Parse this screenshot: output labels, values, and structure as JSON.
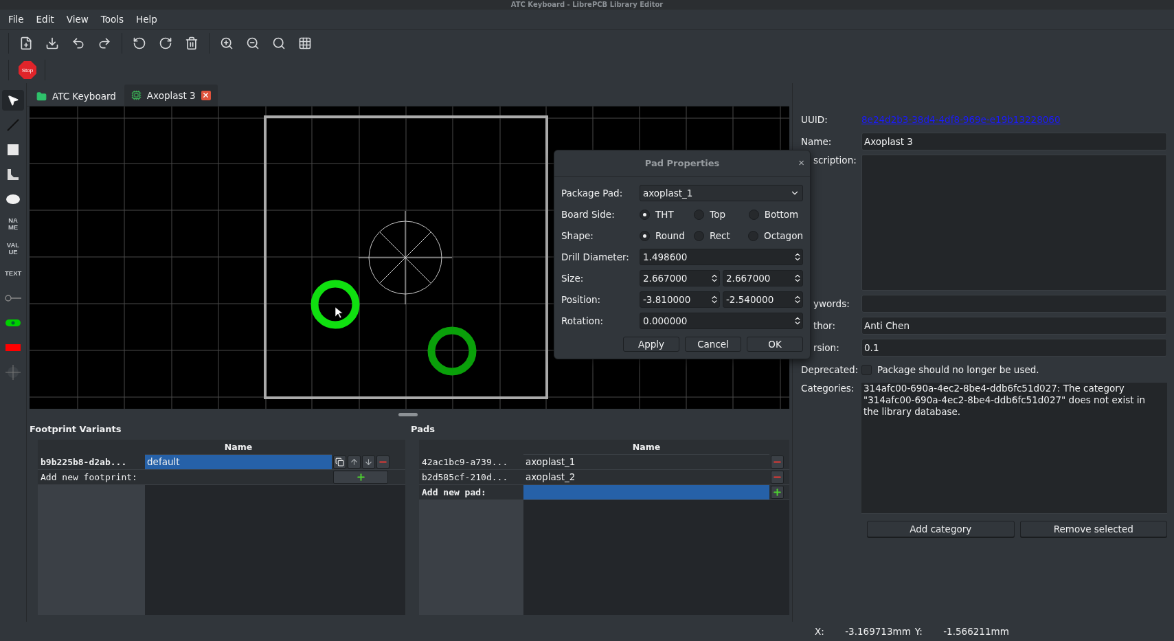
{
  "window": {
    "title": "ATC Keyboard - LibrePCB Library Editor"
  },
  "menu": [
    "File",
    "Edit",
    "View",
    "Tools",
    "Help"
  ],
  "stop_label": "Stop",
  "tools": [
    {
      "kind": "pointer",
      "selected": true
    },
    {
      "kind": "line",
      "selected": false
    },
    {
      "kind": "rect",
      "selected": false
    },
    {
      "kind": "polygon",
      "selected": false
    },
    {
      "kind": "ellipse",
      "selected": false
    },
    {
      "kind": "label",
      "label": "NA ME",
      "selected": false
    },
    {
      "kind": "label",
      "label": "VAL UE",
      "selected": false
    },
    {
      "kind": "small",
      "label": "TEXT",
      "selected": false
    },
    {
      "kind": "hole",
      "selected": false
    },
    {
      "kind": "tht",
      "selected": false
    },
    {
      "kind": "smt",
      "selected": false
    },
    {
      "kind": "origin",
      "selected": false
    }
  ],
  "tabs": [
    {
      "label": "ATC Keyboard",
      "kind": "library",
      "selected": false
    },
    {
      "label": "Axoplast 3",
      "kind": "package",
      "selected": true
    }
  ],
  "footprint_variants": {
    "title": "Footprint Variants",
    "columns": [
      "Name"
    ],
    "add_label": "Add new footprint:",
    "add_selected": false,
    "rows": [
      {
        "id": "b9b225b8-d2ab...",
        "name": "default",
        "selected": true
      }
    ]
  },
  "pads": {
    "title": "Pads",
    "columns": [
      "Name"
    ],
    "add_label": "Add new pad:",
    "add_selected": true,
    "rows": [
      {
        "id": "42ac1bc9-a739...",
        "name": "axoplast_1",
        "selected": false
      },
      {
        "id": "b2d585cf-210d...",
        "name": "axoplast_2",
        "selected": false
      }
    ]
  },
  "properties": {
    "uuid_label": "UUID:",
    "uuid": "8e24d2b3-38d4-4df8-969e-e19b13228060",
    "fields": [
      {
        "label": "Name:",
        "value": "Axoplast 3",
        "kind": "line"
      },
      {
        "label": "scription:",
        "kind": "area"
      },
      {
        "label": "ywords:",
        "kind": "line"
      },
      {
        "label": "thor:",
        "value": "Anti Chen",
        "kind": "line"
      },
      {
        "label": "rsion:",
        "value": "0.1",
        "kind": "line"
      }
    ],
    "deprecated": {
      "label": "Deprecated:",
      "text": "Package should no longer be used.",
      "checked": false
    },
    "categories": {
      "label": "Categories:",
      "text": "314afc00-690a-4ec2-8be4-ddb6fc51d027: The category \"314afc00-690a-4ec2-8be4-ddb6fc51d027\" does not exist in the library database."
    },
    "buttons": [
      "Add category",
      "Remove selected"
    ]
  },
  "dialog": {
    "title": "Pad Properties",
    "close": "×",
    "package_pad": {
      "label": "Package Pad:",
      "value": "axoplast_1"
    },
    "board_side": {
      "label": "Board Side:",
      "options": [
        {
          "label": "THT",
          "selected": true
        },
        {
          "label": "Top",
          "selected": false
        },
        {
          "label": "Bottom",
          "selected": false
        }
      ]
    },
    "shape": {
      "label": "Shape:",
      "options": [
        {
          "label": "Round",
          "selected": true
        },
        {
          "label": "Rect",
          "selected": false
        },
        {
          "label": "Octagon",
          "selected": false
        }
      ]
    },
    "spins": [
      {
        "label": "Drill Diameter:",
        "values": [
          "1.498600"
        ]
      },
      {
        "label": "Size:",
        "values": [
          "2.667000",
          "2.667000"
        ]
      },
      {
        "label": "Position:",
        "values": [
          "-3.810000",
          "-2.540000"
        ]
      },
      {
        "label": "Rotation:",
        "values": [
          "0.000000"
        ]
      }
    ],
    "buttons": [
      "Apply",
      "Cancel",
      "OK"
    ]
  },
  "status_bar": {
    "x_label": "X:",
    "x": "-3.169713mm",
    "y_label": "Y:",
    "y": "-1.566211mm"
  }
}
